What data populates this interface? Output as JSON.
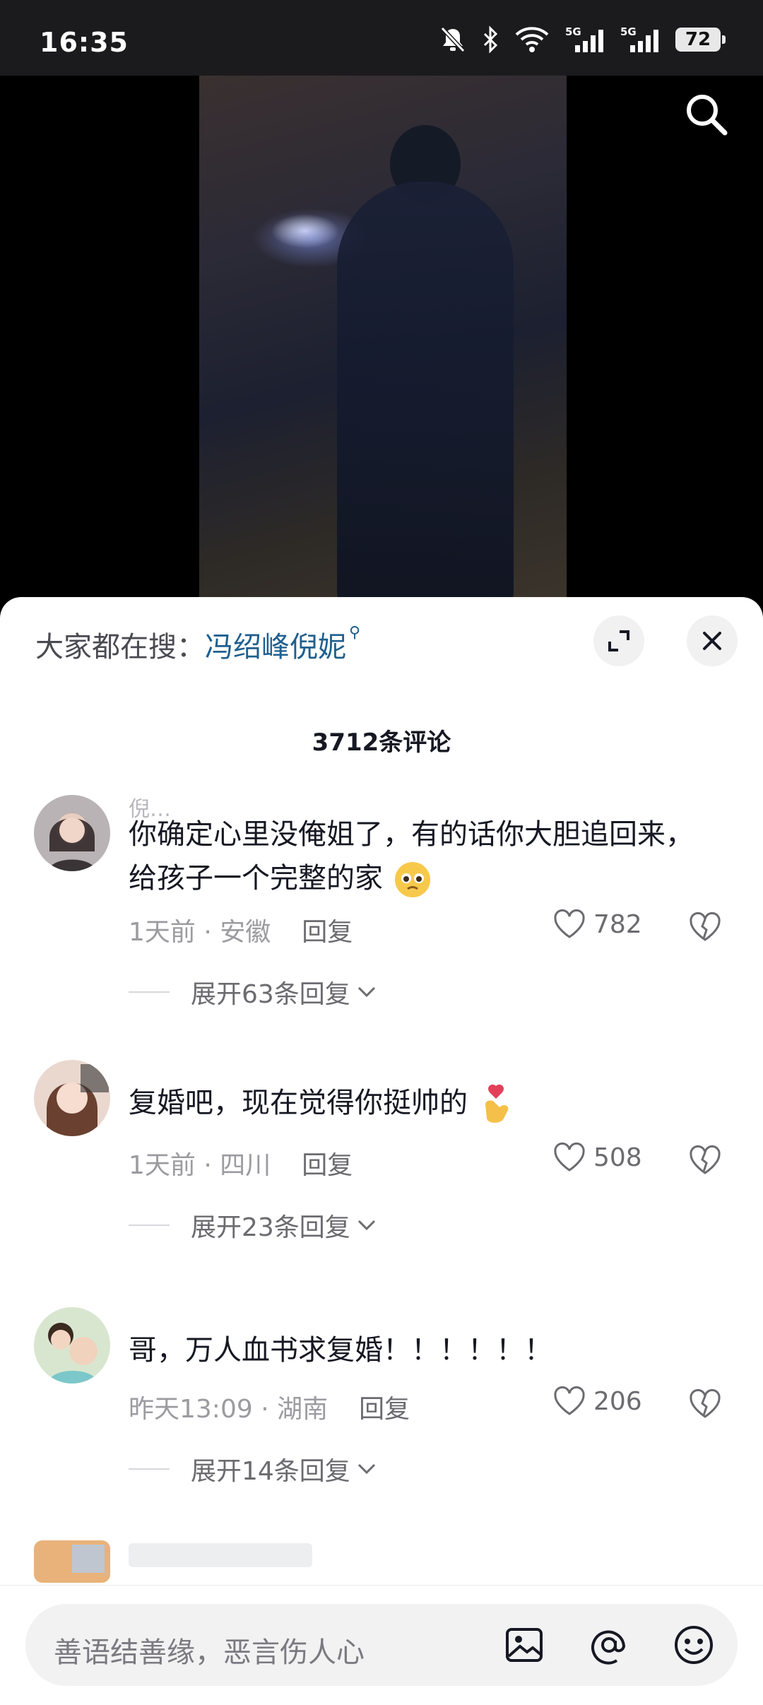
{
  "status_bar": {
    "time": "16:35",
    "battery": "72",
    "network_1": "5G",
    "network_2": "5G"
  },
  "search_suggest": {
    "prefix": "大家都在搜：",
    "term": "冯绍峰倪妮"
  },
  "comment_count": "3712条评论",
  "comments": [
    {
      "name": "倪…",
      "text": "你确定心里没俺姐了，有的话你大胆追回来，给孩子一个完整的家",
      "time": "1天前 · 安徽",
      "reply": "回复",
      "likes": "782",
      "expand": "展开63条回复"
    },
    {
      "name": "",
      "text": "复婚吧，现在觉得你挺帅的",
      "time": "1天前 · 四川",
      "reply": "回复",
      "likes": "508",
      "expand": "展开23条回复"
    },
    {
      "name": "",
      "text": "哥，万人血书求复婚！！！！！！",
      "time": "昨天13:09 · 湖南",
      "reply": "回复",
      "likes": "206",
      "expand": "展开14条回复"
    }
  ],
  "input": {
    "placeholder": "善语结善缘，恶言伤人心"
  },
  "colors": {
    "accent_link": "#1f5f8f",
    "text_primary": "#161823",
    "text_secondary": "#9b9ba0"
  }
}
